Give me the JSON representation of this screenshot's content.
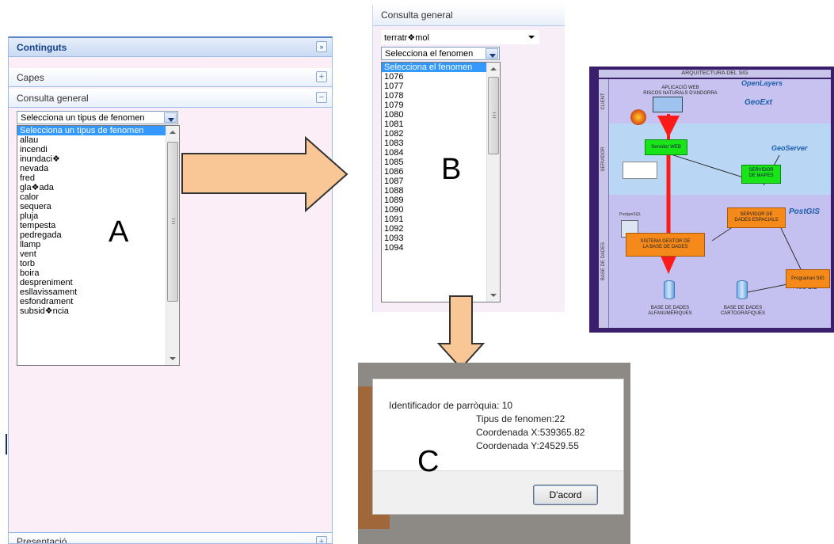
{
  "panel_a": {
    "header": "Continguts",
    "sections": [
      "Capes",
      "Consulta general"
    ],
    "combo_value": "Selecciona un tipus de fenomen",
    "list_items": [
      "Selecciona un tipus de fenomen",
      "allau",
      "incendi",
      "inundaci❖",
      "nevada",
      "fred",
      "gla❖ada",
      "calor",
      "sequera",
      "pluja",
      "tempesta",
      "pedregada",
      "llamp",
      "vent",
      "torb",
      "boira",
      "despreniment",
      "esllavissament",
      "esfondrament",
      "subsid❖ncia"
    ],
    "bottom_section": "Presentació",
    "label": "A"
  },
  "panel_b": {
    "header": "Consulta general",
    "combo1_value": "terratr❖mol",
    "combo2_value": "Selecciona el fenomen",
    "list_items": [
      "Selecciona el fenomen",
      "1076",
      "1077",
      "1078",
      "1079",
      "1080",
      "1081",
      "1082",
      "1083",
      "1084",
      "1085",
      "1086",
      "1087",
      "1088",
      "1089",
      "1090",
      "1091",
      "1092",
      "1093",
      "1094"
    ],
    "label": "B"
  },
  "diagram": {
    "title": "ARQUITECTURA DEL SIG",
    "bands": [
      "CLIENT",
      "SERVIDOR",
      "BASE DE DADES"
    ],
    "client_text": "APLICACIÓ WEB\nRISCOS NATURALS D'ANDORRA",
    "web_server": "Servidor WEB",
    "map_server": "SERVIDOR\nDE MAPES",
    "spatial_server": "SERVIDOR DE\nDADES ESPACIALS",
    "db_system": "SISTEMA GESTOR DE\nLA BASE DE DADES",
    "sig_program": "Programari SIG",
    "db_alpha": "BASE DE DADES\nALFANUMÈRIQUES",
    "db_carto": "BASE DE DADES\nCARTOGRÀFIQUES",
    "logos": [
      "OpenLayers",
      "GeoExt",
      "GeoServer",
      "PostGIS",
      "PostgreSQL",
      "Arc GIS"
    ]
  },
  "panel_c": {
    "lines": [
      "Identificador de parròquia: 10",
      "Tipus de fenomen:22",
      "Coordenada X:539365.82",
      "Coordenada Y:24529.55"
    ],
    "button": "D'acord",
    "label": "C"
  },
  "colors": {
    "arrow_fill": "#f9c795",
    "arrow_stroke": "#333333",
    "selection": "#3399ff",
    "panel_bg": "#fbeef7"
  }
}
